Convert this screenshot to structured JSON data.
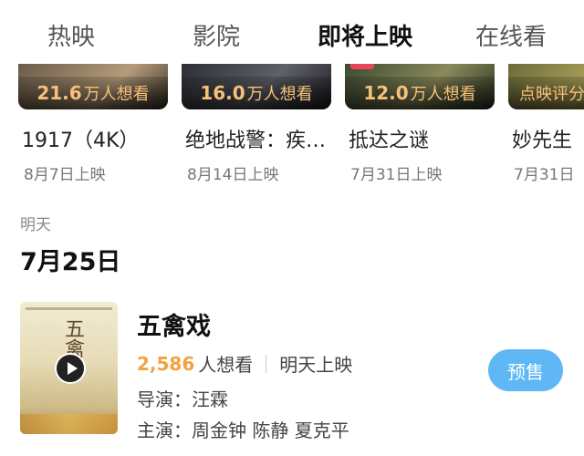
{
  "tabs": [
    "热映",
    "影院",
    "即将上映",
    "在线看"
  ],
  "upcoming": [
    {
      "want_num": "21.6",
      "want_unit": "万人想看",
      "title": "1917（4K）",
      "date": "8月7日上映"
    },
    {
      "want_num": "16.0",
      "want_unit": "万人想看",
      "title": "绝地战警：疾…",
      "date": "8月14日上映"
    },
    {
      "want_num": "12.0",
      "want_unit": "万人想看",
      "title": "抵达之谜",
      "date": "7月31日上映"
    },
    {
      "want_num": "",
      "want_unit": "点映评分",
      "title": "妙先生",
      "date": "7月31日"
    }
  ],
  "section": {
    "day_label": "明天",
    "date_head": "7月25日"
  },
  "movie": {
    "poster_text": "五禽",
    "title": "五禽戏",
    "want_count": "2,586",
    "want_label": "人想看",
    "release": "明天上映",
    "director": "导演：汪霖",
    "cast": "主演：周金钟 陈静 夏克平",
    "presale_label": "预售"
  }
}
